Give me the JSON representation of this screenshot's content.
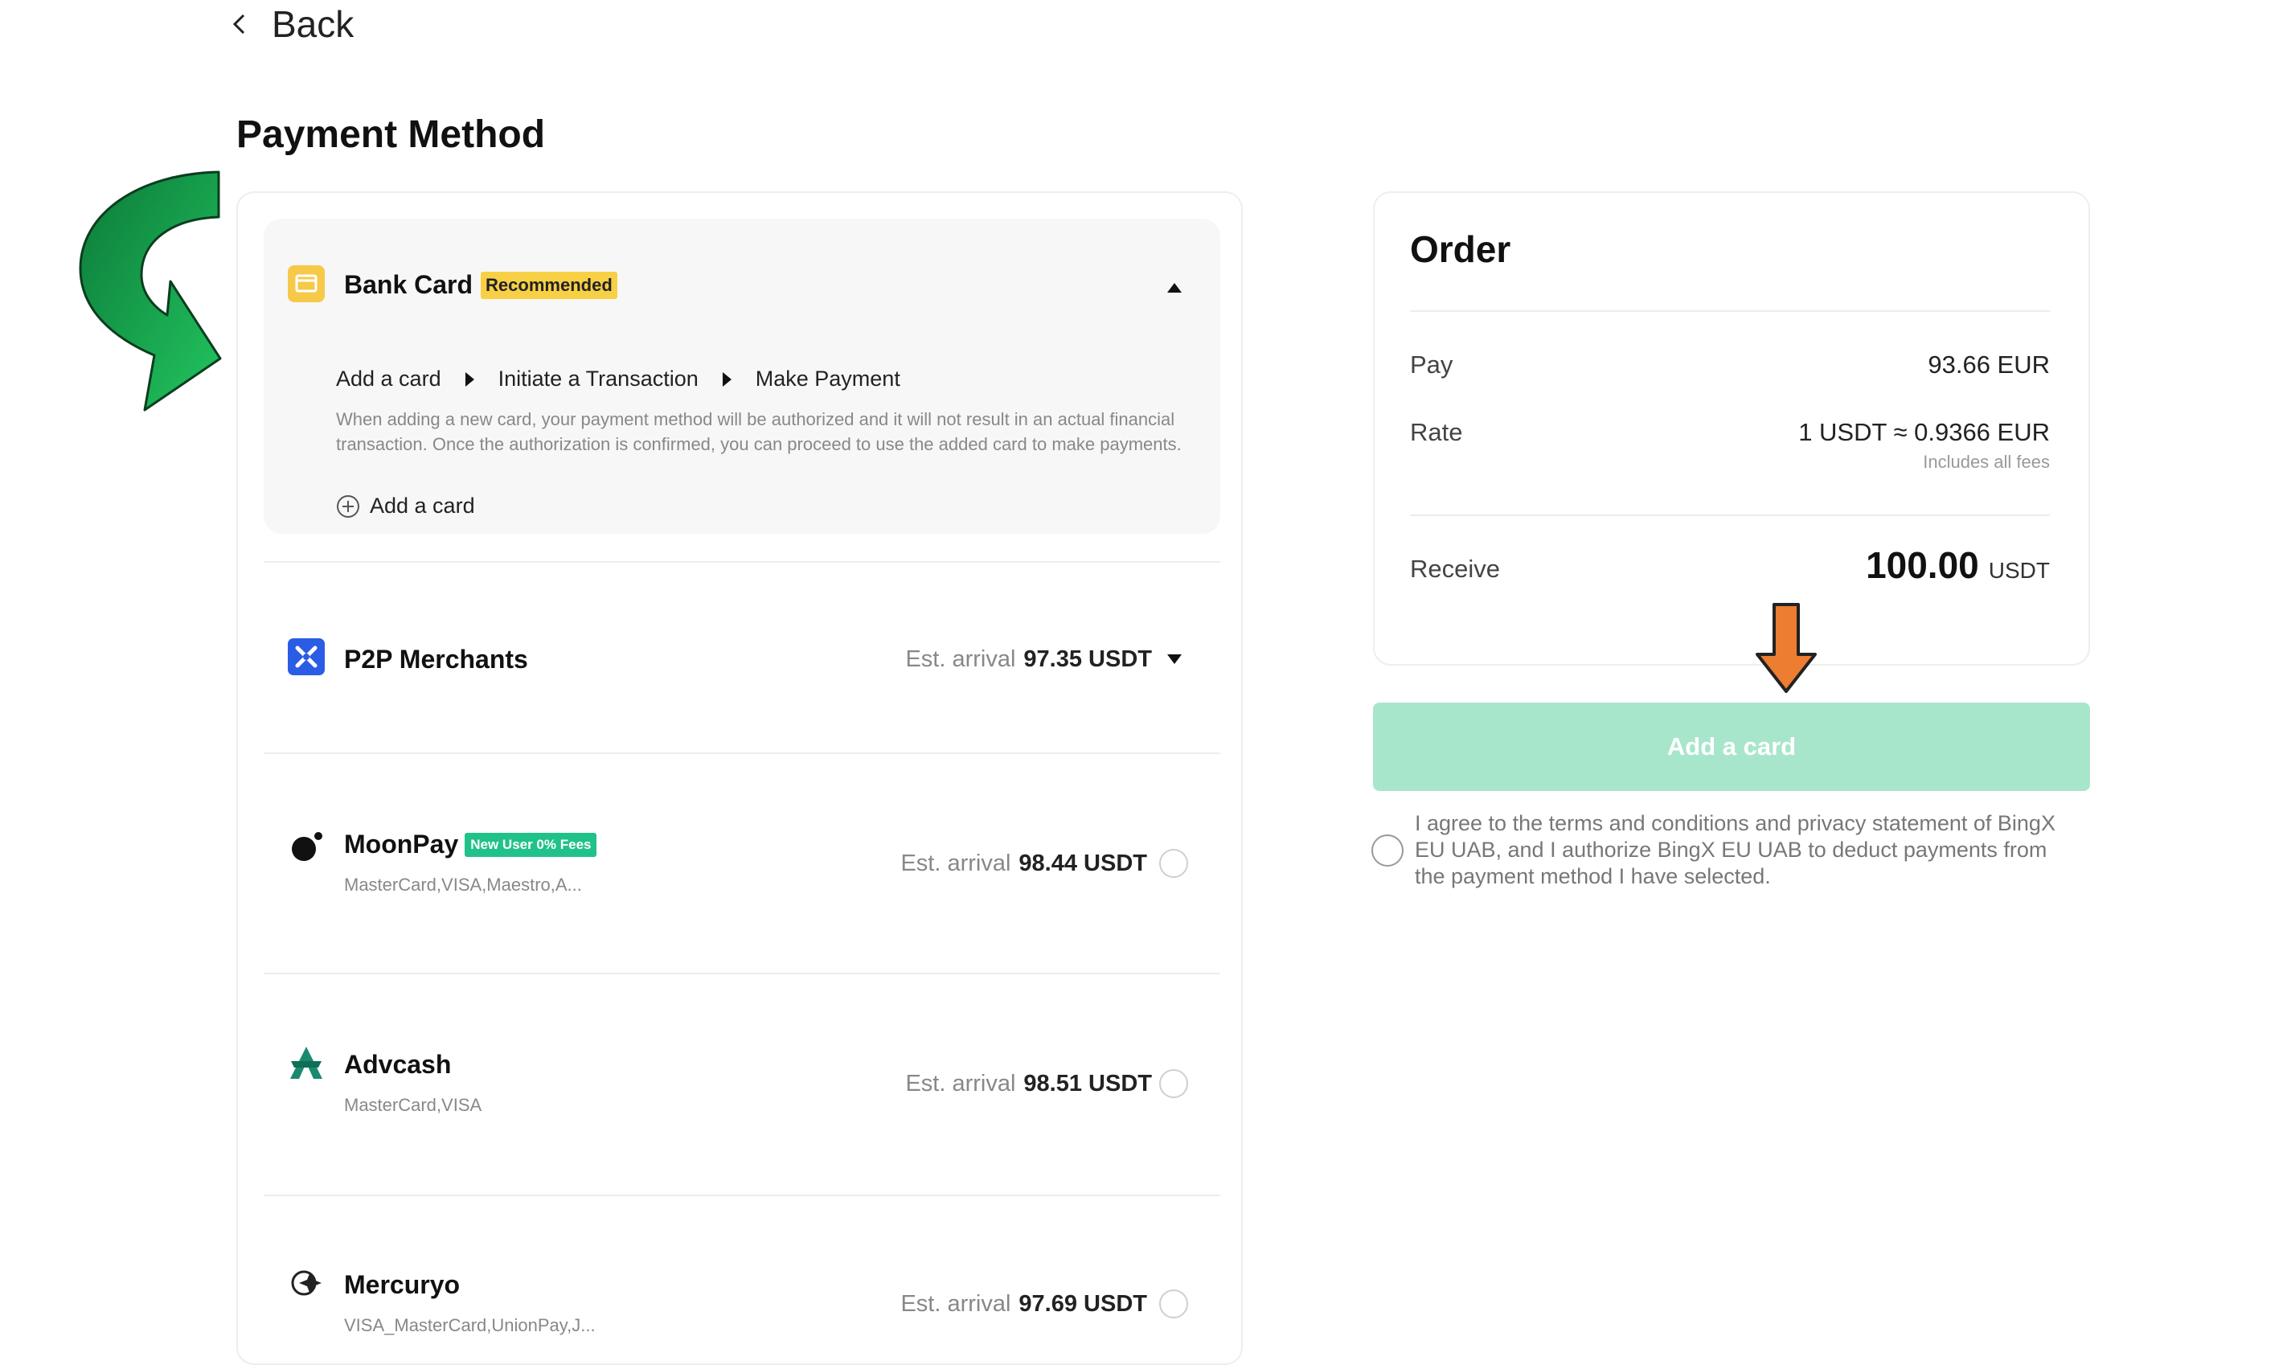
{
  "back_label": "Back",
  "page_title": "Payment Method",
  "bank_card": {
    "name": "Bank Card",
    "badge": "Recommended",
    "steps": [
      "Add a card",
      "Initiate a Transaction",
      "Make Payment"
    ],
    "description": "When adding a new card, your payment method will be authorized and it will not result in an actual financial transaction. Once the authorization is confirmed, you can proceed to use the added card to make payments.",
    "add_card_label": "Add a card"
  },
  "methods": [
    {
      "name": "P2P Merchants",
      "subtitle": "",
      "est_label": "Est. arrival",
      "est_value": "97.35 USDT",
      "control": "dropdown"
    },
    {
      "name": "MoonPay",
      "badge": "New User 0% Fees",
      "subtitle": "MasterCard,VISA,Maestro,A...",
      "est_label": "Est. arrival",
      "est_value": "98.44 USDT",
      "control": "radio"
    },
    {
      "name": "Advcash",
      "subtitle": "MasterCard,VISA",
      "est_label": "Est. arrival",
      "est_value": "98.51 USDT",
      "control": "radio"
    },
    {
      "name": "Mercuryo",
      "subtitle": "VISA_MasterCard,UnionPay,J...",
      "est_label": "Est. arrival",
      "est_value": "97.69 USDT",
      "control": "radio"
    }
  ],
  "order": {
    "title": "Order",
    "pay_label": "Pay",
    "pay_value": "93.66 EUR",
    "rate_label": "Rate",
    "rate_value": "1 USDT ≈ 0.9366 EUR",
    "rate_note": "Includes all fees",
    "receive_label": "Receive",
    "receive_amount": "100.00",
    "receive_unit": "USDT"
  },
  "add_card_button": "Add a card",
  "agreement": "I agree to the terms and conditions and privacy statement of BingX EU UAB, and I authorize BingX EU UAB to deduct payments from the payment method I have selected.",
  "colors": {
    "accent_green": "#a8e6cc",
    "badge_yellow": "#f7d046",
    "badge_green": "#21c28a",
    "annotation_green": "#22b14c",
    "annotation_orange": "#ed7d31"
  },
  "icons": [
    "chevron-left-icon",
    "bank-card-icon",
    "caret-up-icon",
    "p2p-icon",
    "caret-down-icon",
    "moonpay-icon",
    "advcash-icon",
    "mercuryo-icon",
    "plus-circle-icon",
    "curved-arrow-annotation",
    "down-arrow-annotation"
  ]
}
